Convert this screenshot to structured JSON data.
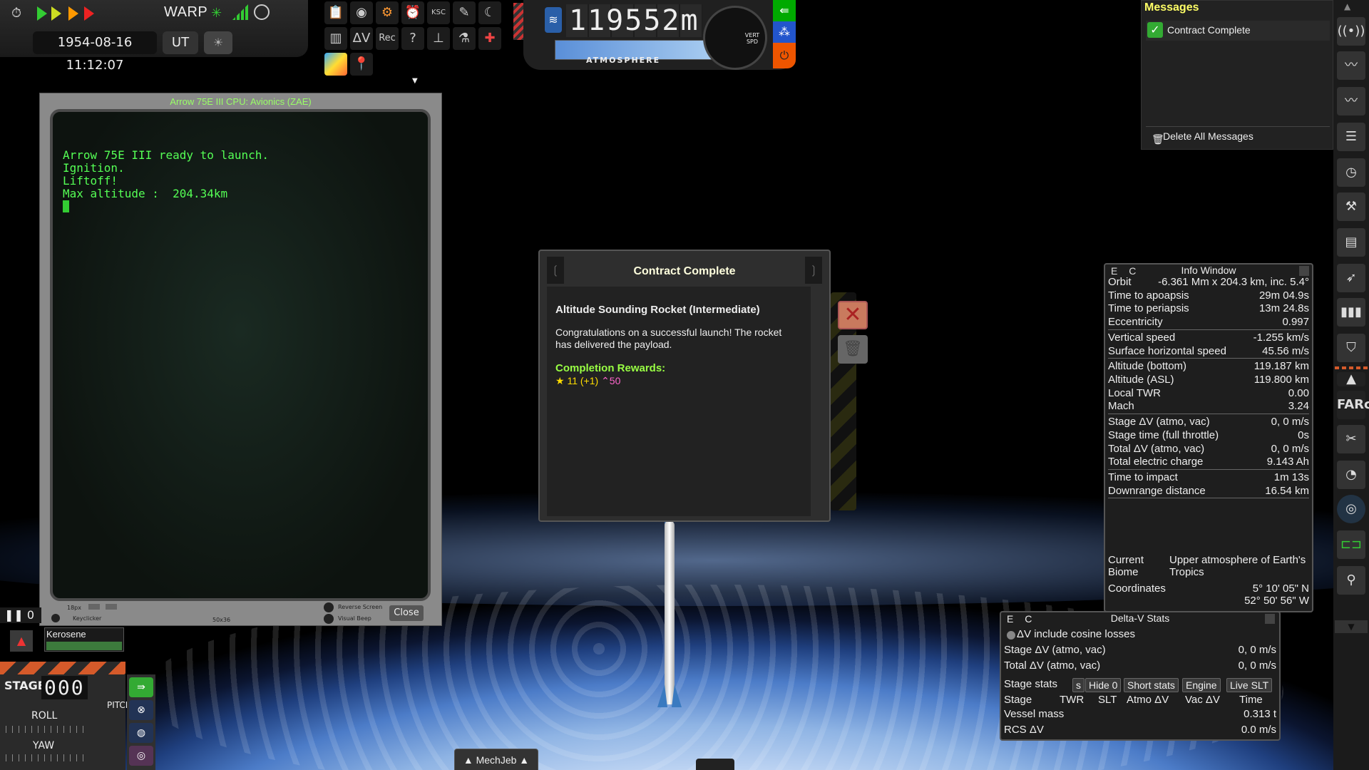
{
  "timebar": {
    "warp_label": "WARP",
    "date": "1954-08-16 11:12:07",
    "ut_label": "UT"
  },
  "toolbar": {
    "dv_label": "ΔV",
    "rec_label": "Rec"
  },
  "altimeter": {
    "altitude_value": "119552",
    "altitude_unit": "m",
    "atmosphere_label": "ATMOSPHERE",
    "gauge_label": "VERT SPD"
  },
  "cpu_window": {
    "title": "Arrow 75E III CPU: Avionics (ZAE)",
    "terminal_text": "Arrow 75E III ready to launch.\nIgnition.\nLiftoff!\nMax altitude :  204.34km",
    "font_size_label": "18px",
    "size_label": "50x36",
    "keyclicker_label": "Keyclicker",
    "reverse_screen_label": "Reverse Screen",
    "visual_beep_label": "Visual Beep",
    "close_label": "Close"
  },
  "contract_dialog": {
    "title": "Contract Complete",
    "heading": "Altitude Sounding Rocket (Intermediate)",
    "body": "Congratulations on a successful launch! The rocket has delivered the payload.",
    "rewards_label": "Completion Rewards:",
    "science_reward": "11 (+1)",
    "reputation_reward": "50"
  },
  "messages": {
    "title": "Messages",
    "items": [
      {
        "label": "Contract Complete"
      }
    ],
    "delete_all_label": "Delete All Messages"
  },
  "info_window": {
    "title": "Info Window",
    "ec_label": "E C",
    "rows": [
      {
        "label": "Orbit",
        "value": "-6.361 Mm x 204.3 km, inc. 5.4°"
      },
      {
        "label": "Time to apoapsis",
        "value": "29m 04.9s"
      },
      {
        "label": "Time to periapsis",
        "value": "13m 24.8s"
      },
      {
        "label": "Eccentricity",
        "value": "0.997"
      },
      {
        "label": "Vertical speed",
        "value": "-1.255 km/s"
      },
      {
        "label": "Surface horizontal speed",
        "value": "45.56  m/s"
      },
      {
        "label": "Altitude (bottom)",
        "value": "119.187 km"
      },
      {
        "label": "Altitude (ASL)",
        "value": "119.800 km"
      },
      {
        "label": "Local TWR",
        "value": "0.00"
      },
      {
        "label": "Mach",
        "value": "3.24"
      },
      {
        "label": "Stage ΔV (atmo, vac)",
        "value": "0, 0 m/s"
      },
      {
        "label": "Stage time (full throttle)",
        "value": "0s"
      },
      {
        "label": "Total ΔV (atmo, vac)",
        "value": "0, 0 m/s"
      },
      {
        "label": "Total electric charge",
        "value": "9.143  Ah"
      },
      {
        "label": "Time to impact",
        "value": "1m 13s"
      },
      {
        "label": "Downrange distance",
        "value": "16.54 km"
      }
    ],
    "biome_label_1": "Current",
    "biome_label_2": "Biome",
    "biome_value_1": "Upper atmosphere of Earth's",
    "biome_value_2": "Tropics",
    "coords_label": "Coordinates",
    "coords_lat": "5° 10' 05\" N",
    "coords_lon": "52° 50' 56\" W"
  },
  "deltav_window": {
    "title": "Delta-V Stats",
    "ec_label": "E C",
    "cosine_label": "ΔV include cosine losses",
    "stage_dv_label": "Stage ΔV (atmo, vac)",
    "stage_dv_value": "0, 0 m/s",
    "total_dv_label": "Total ΔV (atmo, vac)",
    "total_dv_value": "0, 0 m/s",
    "stage_stats_label": "Stage stats",
    "tabs": [
      "s",
      "Hide 0",
      "Short stats",
      "Engine",
      "Live SLT"
    ],
    "columns": [
      "Stage",
      "TWR",
      "SLT",
      "Atmo ΔV",
      "Vac ΔV",
      "Time"
    ],
    "vessel_mass_label": "Vessel mass",
    "vessel_mass_value": "0.313 t",
    "rcs_label": "RCS ΔV",
    "rcs_value": "0.0 m/s"
  },
  "bottom_left": {
    "pause_label": "0",
    "resource_name": "Kerosene",
    "resource_fraction": 1.0,
    "stage_label": "STAGE",
    "stage_value": "000",
    "roll_label": "ROLL",
    "yaw_label": "YAW",
    "pitch_label": "PITCH"
  },
  "sidebar_right": {
    "farc_label": "FARc"
  },
  "mechjeb": {
    "label": "▲ MechJeb ▲"
  },
  "colors": {
    "terminal_green": "#55ff55",
    "title_yellow": "#ffff66",
    "rewards_green": "#99ff44",
    "reputation_pink": "#ff66cc",
    "close_red": "#c97a5e"
  }
}
